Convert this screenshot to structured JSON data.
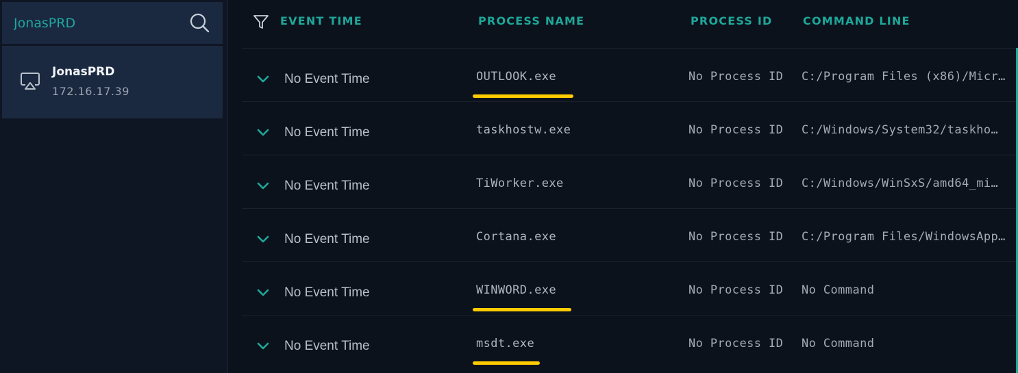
{
  "sidebar": {
    "search": {
      "placeholder": "JonasPRD"
    },
    "host": {
      "name": "JonasPRD",
      "ip": "172.16.17.39",
      "icon": "airplay-icon"
    }
  },
  "table": {
    "columns": {
      "event_time": "EVENT TIME",
      "process_name": "PROCESS NAME",
      "process_id": "PROCESS ID",
      "command_line": "COMMAND LINE"
    },
    "rows": [
      {
        "event_time": "No Event Time",
        "process_name": "OUTLOOK.exe",
        "process_id": "No Process ID",
        "command_line": "C:/Program Files (x86)/Micros…",
        "highlighted": true
      },
      {
        "event_time": "No Event Time",
        "process_name": "taskhostw.exe",
        "process_id": "No Process ID",
        "command_line": "C:/Windows/System32/taskho…",
        "highlighted": false
      },
      {
        "event_time": "No Event Time",
        "process_name": "TiWorker.exe",
        "process_id": "No Process ID",
        "command_line": "C:/Windows/WinSxS/amd64_mi…",
        "highlighted": false
      },
      {
        "event_time": "No Event Time",
        "process_name": "Cortana.exe",
        "process_id": "No Process ID",
        "command_line": "C:/Program Files/WindowsApp…",
        "highlighted": false
      },
      {
        "event_time": "No Event Time",
        "process_name": "WINWORD.exe",
        "process_id": "No Process ID",
        "command_line": "No Command",
        "highlighted": true
      },
      {
        "event_time": "No Event Time",
        "process_name": "msdt.exe",
        "process_id": "No Process ID",
        "command_line": "No Command",
        "highlighted": true
      }
    ]
  },
  "colors": {
    "accent": "#1ea89a",
    "highlight": "#ffcc00",
    "sidebar_card": "#1a2840",
    "background": "#0c121c"
  }
}
